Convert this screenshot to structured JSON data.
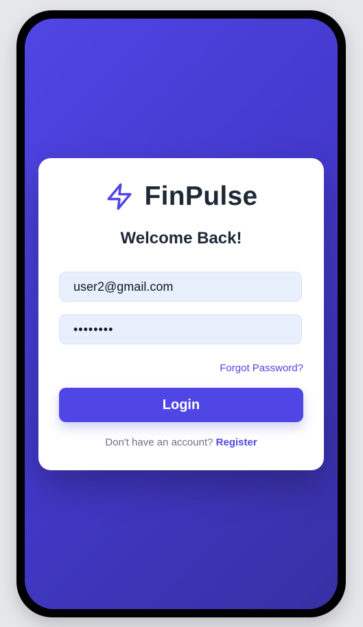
{
  "brand": {
    "name": "FinPulse",
    "icon": "lightning-bolt-icon",
    "accent_color": "#4f46e5"
  },
  "login": {
    "heading": "Welcome Back!",
    "email_value": "user2@gmail.com",
    "password_value": "password",
    "forgot_label": "Forgot Password?",
    "submit_label": "Login",
    "no_account_text": "Don't have an account?",
    "register_label": "Register"
  },
  "colors": {
    "gradient_start": "#4f46e5",
    "gradient_end": "#3730a3",
    "input_bg": "#e8f0fe",
    "text_dark": "#1f2937",
    "muted": "#6b7280"
  }
}
